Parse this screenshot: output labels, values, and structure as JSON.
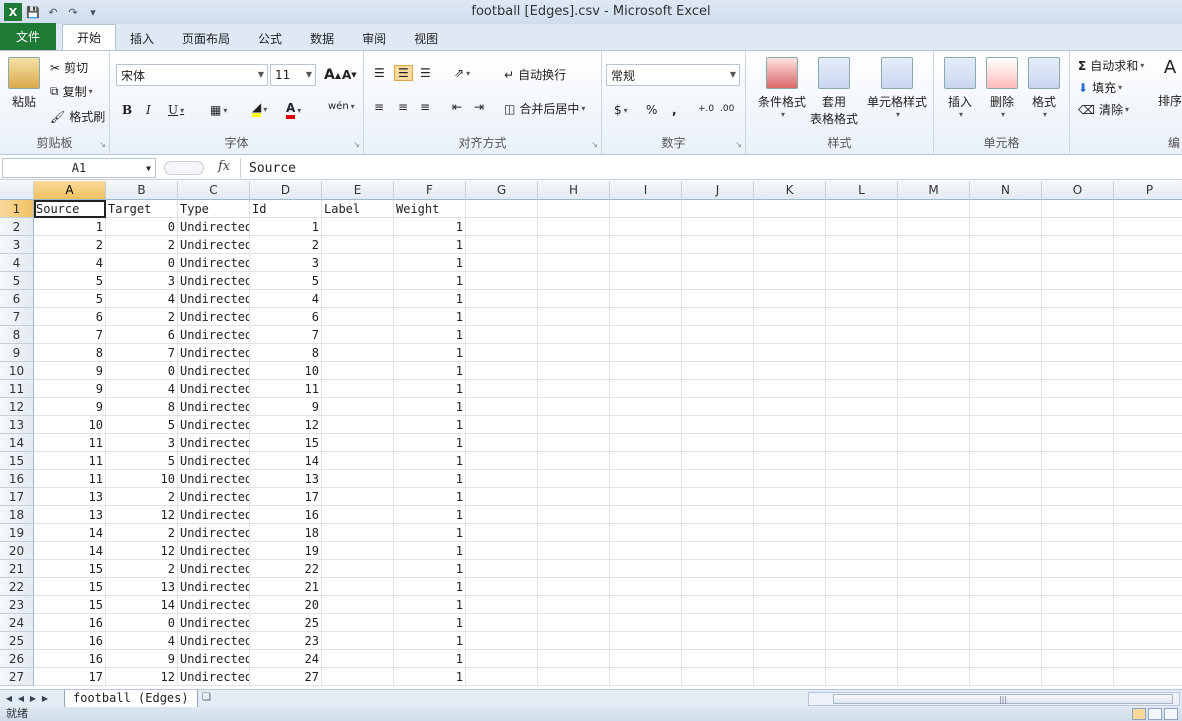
{
  "window": {
    "title": "football [Edges].csv  -  Microsoft Excel"
  },
  "qat": {
    "save": "save-icon",
    "undo": "undo-icon",
    "redo": "redo-icon"
  },
  "tabs": [
    {
      "label": "文件"
    },
    {
      "label": "开始"
    },
    {
      "label": "插入"
    },
    {
      "label": "页面布局"
    },
    {
      "label": "公式"
    },
    {
      "label": "数据"
    },
    {
      "label": "审阅"
    },
    {
      "label": "视图"
    }
  ],
  "ribbon": {
    "clipboard": {
      "label": "剪贴板",
      "paste": "粘贴",
      "cut": "剪切",
      "copy": "复制",
      "format_painter": "格式刷"
    },
    "font": {
      "label": "字体",
      "name": "宋体",
      "size": "11"
    },
    "alignment": {
      "label": "对齐方式",
      "wrap": "自动换行",
      "merge": "合并后居中"
    },
    "number": {
      "label": "数字",
      "format": "常规"
    },
    "styles": {
      "label": "样式",
      "conditional": "条件格式",
      "table_line1": "套用",
      "table_line2": "表格格式",
      "cell_styles": "单元格样式"
    },
    "cells": {
      "label": "单元格",
      "insert": "插入",
      "delete": "删除",
      "format": "格式"
    },
    "editing": {
      "autosum": "自动求和",
      "fill": "填充",
      "clear": "清除",
      "sort": "排序",
      "partial_label": "编"
    }
  },
  "formula_bar": {
    "name_box": "A1",
    "fx": "fx",
    "content": "Source"
  },
  "columns": [
    "A",
    "B",
    "C",
    "D",
    "E",
    "F",
    "G",
    "H",
    "I",
    "J",
    "K",
    "L",
    "M",
    "N",
    "O",
    "P"
  ],
  "header_row": [
    "Source",
    "Target",
    "Type",
    "Id",
    "Label",
    "Weight"
  ],
  "rows": [
    [
      1,
      0,
      "Undirected",
      1,
      "",
      1
    ],
    [
      2,
      2,
      "Undirected",
      2,
      "",
      1
    ],
    [
      4,
      0,
      "Undirected",
      3,
      "",
      1
    ],
    [
      5,
      3,
      "Undirected",
      5,
      "",
      1
    ],
    [
      5,
      4,
      "Undirected",
      4,
      "",
      1
    ],
    [
      6,
      2,
      "Undirected",
      6,
      "",
      1
    ],
    [
      7,
      6,
      "Undirected",
      7,
      "",
      1
    ],
    [
      8,
      7,
      "Undirected",
      8,
      "",
      1
    ],
    [
      9,
      0,
      "Undirected",
      10,
      "",
      1
    ],
    [
      9,
      4,
      "Undirected",
      11,
      "",
      1
    ],
    [
      9,
      8,
      "Undirected",
      9,
      "",
      1
    ],
    [
      10,
      5,
      "Undirected",
      12,
      "",
      1
    ],
    [
      11,
      3,
      "Undirected",
      15,
      "",
      1
    ],
    [
      11,
      5,
      "Undirected",
      14,
      "",
      1
    ],
    [
      11,
      10,
      "Undirected",
      13,
      "",
      1
    ],
    [
      13,
      2,
      "Undirected",
      17,
      "",
      1
    ],
    [
      13,
      12,
      "Undirected",
      16,
      "",
      1
    ],
    [
      14,
      2,
      "Undirected",
      18,
      "",
      1
    ],
    [
      14,
      12,
      "Undirected",
      19,
      "",
      1
    ],
    [
      15,
      2,
      "Undirected",
      22,
      "",
      1
    ],
    [
      15,
      13,
      "Undirected",
      21,
      "",
      1
    ],
    [
      15,
      14,
      "Undirected",
      20,
      "",
      1
    ],
    [
      16,
      0,
      "Undirected",
      25,
      "",
      1
    ],
    [
      16,
      4,
      "Undirected",
      23,
      "",
      1
    ],
    [
      16,
      9,
      "Undirected",
      24,
      "",
      1
    ],
    [
      17,
      12,
      "Undirected",
      27,
      "",
      1
    ]
  ],
  "row_numbers": [
    "1",
    "2",
    "3",
    "4",
    "5",
    "6",
    "7",
    "8",
    "9",
    "10",
    "11",
    "12",
    "13",
    "14",
    "15",
    "16",
    "17",
    "18",
    "19",
    "20",
    "21",
    "22",
    "23",
    "24",
    "25",
    "26",
    "27"
  ],
  "sheet_tab": "football (Edges)",
  "status": "就绪",
  "colors": {
    "file_tab": "#1f7a36",
    "selected_header": "#f1c15f"
  }
}
